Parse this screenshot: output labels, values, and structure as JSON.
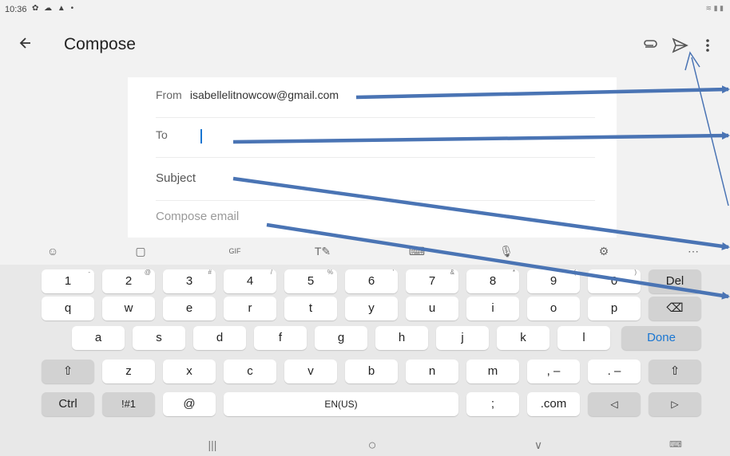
{
  "status_bar": {
    "time": "10:36",
    "left_icons": "✿ ☁ ▲ •",
    "right_icons": "≋ ▮ ▮"
  },
  "appbar": {
    "title": "Compose"
  },
  "compose": {
    "from_label": "From",
    "from_value": "isabellelitnowcow@gmail.com",
    "to_label": "To",
    "subject_placeholder": "Subject",
    "body_placeholder": "Compose email"
  },
  "keyboard": {
    "toolbar": [
      "☺",
      "▢",
      "GIF",
      "T✎",
      "⌨",
      "🎙",
      "⚙",
      "⋯"
    ],
    "row_numbers": [
      {
        "label": "1",
        "sup": "-"
      },
      {
        "label": "2",
        "sup": "@"
      },
      {
        "label": "3",
        "sup": "#"
      },
      {
        "label": "4",
        "sup": "/"
      },
      {
        "label": "5",
        "sup": "%"
      },
      {
        "label": "6",
        "sup": "'"
      },
      {
        "label": "7",
        "sup": "&"
      },
      {
        "label": "8",
        "sup": "*"
      },
      {
        "label": "9",
        "sup": "("
      },
      {
        "label": "0",
        "sup": ")"
      },
      {
        "label": "Del",
        "sup": ""
      }
    ],
    "row_q": [
      "q",
      "w",
      "e",
      "r",
      "t",
      "y",
      "u",
      "i",
      "o",
      "p",
      "⌫"
    ],
    "row_a": [
      "a",
      "s",
      "d",
      "f",
      "g",
      "h",
      "j",
      "k",
      "l",
      "Done"
    ],
    "row_z": [
      "⇧",
      "z",
      "x",
      "c",
      "v",
      "b",
      "n",
      "m",
      ", –",
      ". –",
      "⇧"
    ],
    "row_bottom": [
      "Ctrl",
      "!#1",
      "@",
      "EN(US)",
      ";",
      ".com",
      "◁",
      "▷"
    ]
  },
  "navbar": {
    "recents": "|||",
    "home": "○",
    "back": "∨",
    "keyboard": "⌨"
  },
  "colors": {
    "annotation_arrow": "#4a74b4",
    "accent": "#1976d2",
    "background": "#f2f2f2"
  }
}
